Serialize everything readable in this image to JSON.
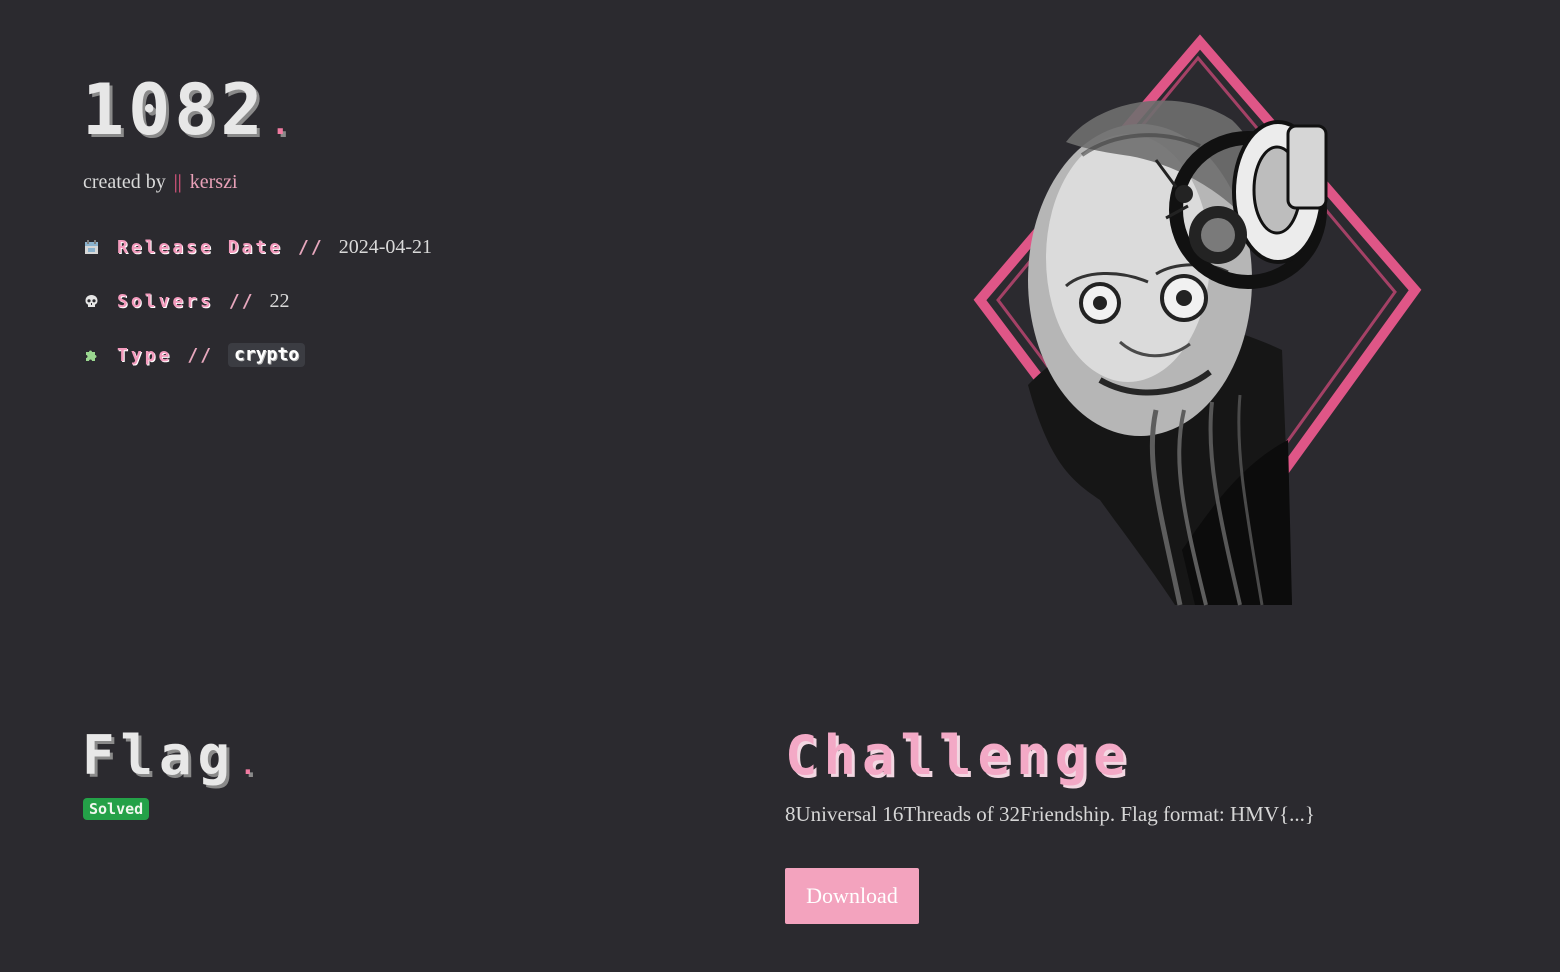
{
  "hero": {
    "title": "1082",
    "dot": ".",
    "creator_prefix": "created by",
    "creator_separator": "||",
    "creator_name": "kerszi"
  },
  "meta": {
    "release_date": {
      "icon": "calendar-icon",
      "label": "Release Date",
      "separator": "//",
      "value": "2024-04-21"
    },
    "solvers": {
      "icon": "skull-icon",
      "label": "Solvers",
      "separator": "//",
      "value": "22"
    },
    "type": {
      "icon": "puzzle-icon",
      "label": "Type",
      "separator": "//",
      "value": "crypto"
    }
  },
  "flag": {
    "title": "Flag",
    "dot": ".",
    "status": "Solved"
  },
  "challenge": {
    "title": "Challenge",
    "description": "8Universal 16Threads of 32Friendship. Flag format: HMV{...}",
    "download_label": "Download"
  },
  "colors": {
    "background": "#2b2a2f",
    "accent_pink": "#f3a3be",
    "accent_red": "#f05a87",
    "success_green": "#24a148",
    "text": "#d9d9d9"
  }
}
